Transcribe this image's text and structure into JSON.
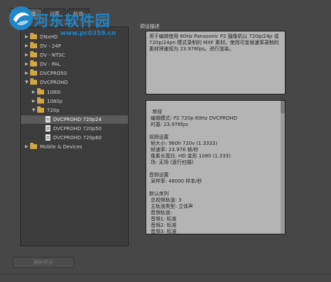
{
  "tabs": [
    "序列预设",
    "设置",
    "轨道"
  ],
  "watermark": {
    "title": "河东软件园",
    "url": "www.pc0359.cn"
  },
  "tree": [
    {
      "label": "DNxHD",
      "type": "folder",
      "expanded": false,
      "depth": 0
    },
    {
      "label": "DV - 24P",
      "type": "folder",
      "expanded": false,
      "depth": 0
    },
    {
      "label": "DV - NTSC",
      "type": "folder",
      "expanded": false,
      "depth": 0
    },
    {
      "label": "DV - PAL",
      "type": "folder",
      "expanded": false,
      "depth": 0
    },
    {
      "label": "DVCPRO50",
      "type": "folder",
      "expanded": false,
      "depth": 0
    },
    {
      "label": "DVCPROHD",
      "type": "folder",
      "expanded": true,
      "depth": 0
    },
    {
      "label": "1080i",
      "type": "folder",
      "expanded": false,
      "depth": 1
    },
    {
      "label": "1080p",
      "type": "folder",
      "expanded": false,
      "depth": 1
    },
    {
      "label": "720p",
      "type": "folder",
      "expanded": true,
      "depth": 1
    },
    {
      "label": "DVCPROHD 720p24",
      "type": "preset",
      "selected": true,
      "depth": 2
    },
    {
      "label": "DVCPROHD 720p50",
      "type": "preset",
      "depth": 2
    },
    {
      "label": "DVCPROHD 720p60",
      "type": "preset",
      "depth": 2
    },
    {
      "label": "Mobile & Devices",
      "type": "folder",
      "expanded": false,
      "depth": 0
    }
  ],
  "description": {
    "label": "预设描述",
    "text": "用于编辑使用 60Hz Panasonic P2 摄像机以 720p/24p 或 720p/24pn 模式录制的 MXF 素材。使用可变帧速率录制的素材将被视为 23.976fps。进行渲染。"
  },
  "details": {
    "text": "常规\n 编辑模式: P2 720p 60Hz DVCPROHD\n 时基: 23.976fps\n\n视频设置\n 帧大小: 960h 720v (1.3333)\n 帧速率: 23.976 帧/秒\n 像素长宽比: HD 变形 1080 (1.333)\n 场: 无场 (逐行扫描)\n\n音频设置\n 采样率: 48000 样本/秒\n\n默认序列\n 总视频轨道: 3\n 主轨道类型: 立体声\n 音频轨道:\n 音频1: 标准\n 音频2: 标准\n 音频3: 标准\n 音频4: 标准"
  },
  "buttons": {
    "delete": "删除预设"
  }
}
